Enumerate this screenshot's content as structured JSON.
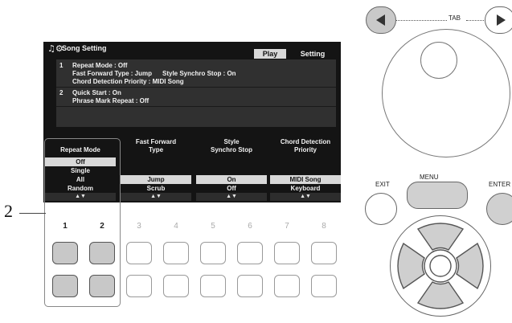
{
  "screen": {
    "title": "Song Setting",
    "tabs": [
      "Play",
      "Setting"
    ],
    "rows": [
      {
        "num": "1",
        "text": "Repeat Mode : Off",
        "text2": ""
      },
      {
        "num": "",
        "text": "Fast Forward Type : Jump",
        "text2": "Style Synchro Stop : On"
      },
      {
        "num": "",
        "text": "Chord Detection Priority : MIDI Song",
        "text2": ""
      },
      {
        "num": "2",
        "text": "Quick Start : On",
        "text2": ""
      },
      {
        "num": "",
        "text": "Phrase Mark Repeat : Off",
        "text2": ""
      }
    ],
    "columns": [
      {
        "label_lines": [
          "Repeat Mode"
        ],
        "options": [
          "Off",
          "Single",
          "All",
          "Random"
        ],
        "selected": 0
      },
      {
        "label_lines": [
          "Fast Forward",
          "Type"
        ],
        "options": [
          "Jump",
          "Scrub"
        ],
        "selected": 0
      },
      {
        "label_lines": [
          "Style",
          "Synchro Stop"
        ],
        "options": [
          "On",
          "Off"
        ],
        "selected": 0
      },
      {
        "label_lines": [
          "Chord Detection",
          "Priority"
        ],
        "options": [
          "MIDI Song",
          "Keyboard"
        ],
        "selected": 0
      }
    ],
    "scroll_arrows": "▲▼"
  },
  "callout": "2",
  "buttons": {
    "numbers": [
      "1",
      "2",
      "3",
      "4",
      "5",
      "6",
      "7",
      "8"
    ],
    "highlighted": [
      "1",
      "2"
    ]
  },
  "panel": {
    "tab_label": "TAB",
    "menu_label": "MENU",
    "exit_label": "EXIT",
    "enter_label": "ENTER"
  }
}
